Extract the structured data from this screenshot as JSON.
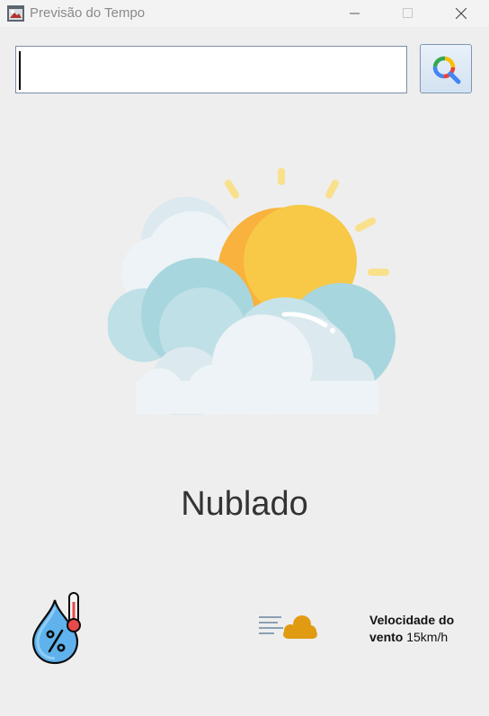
{
  "window": {
    "title": "Previsão do Tempo",
    "icon": "app-window-icon",
    "controls": [
      "minimize-icon",
      "maximize-icon",
      "close-icon"
    ]
  },
  "search": {
    "value": "",
    "placeholder": "",
    "button_icon": "search-icon"
  },
  "weather": {
    "icon": "sun-behind-clouds-icon",
    "condition": "Nublado"
  },
  "humidity": {
    "icon": "humidity-drop-thermometer-icon"
  },
  "wind": {
    "icon": "wind-cloud-icon",
    "label": "Velocidade do vento",
    "value": "15km/h"
  },
  "colors": {
    "background": "#eeeeee",
    "sun": "#f8c847",
    "sun_shadow": "#f6a93b",
    "cloud_light": "#eef4f7",
    "cloud_blue": "#a9d6de",
    "wind_cloud": "#e19b13"
  }
}
